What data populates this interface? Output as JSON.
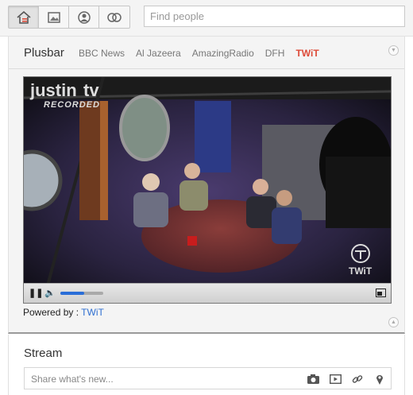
{
  "topbar": {
    "nav": [
      "home-icon",
      "photos-icon",
      "profile-icon",
      "circles-icon"
    ],
    "search_placeholder": "Find people"
  },
  "plusbar": {
    "title": "Plusbar",
    "tabs": [
      "BBC News",
      "Al Jazeera",
      "AmazingRadio",
      "DFH",
      "TWiT"
    ],
    "active_tab": "TWiT",
    "video": {
      "volume_level": 0.55
    },
    "powered_label": "Powered by :",
    "powered_link": "TWiT"
  },
  "stream": {
    "title": "Stream",
    "share_placeholder": "Share what's new...",
    "share_icons": [
      "camera-icon",
      "video-icon",
      "link-icon",
      "location-icon"
    ]
  },
  "colors": {
    "accent": "#dd4b39",
    "link": "#2f6fd1"
  }
}
